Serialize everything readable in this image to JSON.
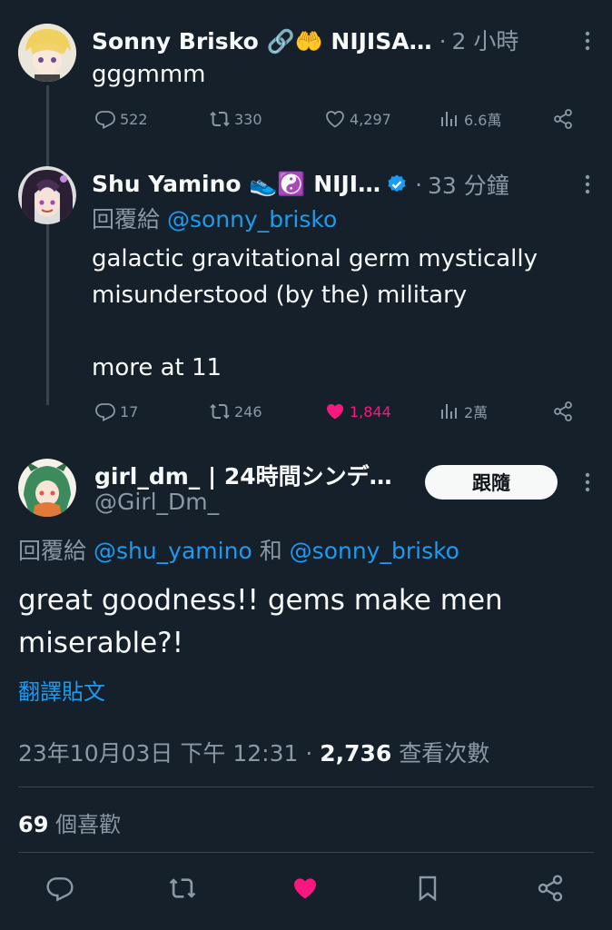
{
  "tweets": [
    {
      "display_name": "Sonny Brisko 🔗🤲 NIJISA…",
      "separator": "·",
      "time": "2 小時",
      "text": "gggmmm",
      "stats": {
        "replies": "522",
        "retweets": "330",
        "likes": "4,297",
        "views": "6.6萬"
      },
      "liked": false
    },
    {
      "display_name": "Shu Yamino 👟☯️ NIJI…",
      "separator": "·",
      "time": "33 分鐘",
      "reply_label": "回覆給",
      "reply_to": "@sonny_brisko",
      "text_line1": "galactic gravitational germ mystically",
      "text_line2": "misunderstood (by the) military",
      "text_line3": "more at 11",
      "stats": {
        "replies": "17",
        "retweets": "246",
        "likes": "1,844",
        "views": "2萬"
      },
      "liked": true
    }
  ],
  "main_tweet": {
    "display_name": "girl_dm_ | 24時間シンデ…",
    "handle": "@Girl_Dm_",
    "follow_label": "跟隨",
    "reply_label": "回覆給",
    "reply_to_1": "@shu_yamino",
    "reply_conj": "和",
    "reply_to_2": "@sonny_brisko",
    "text_line1": "great goodness!! gems make men",
    "text_line2": "miserable?!",
    "translate_label": "翻譯貼文",
    "timestamp": "23年10月03日 下午 12:31",
    "dot": "·",
    "views_count": "2,736",
    "views_label": "查看次數",
    "likes_count": "69",
    "likes_label": "個喜歡"
  },
  "colors": {
    "background": "#15202b",
    "text": "#f7f9f9",
    "muted": "#8b98a5",
    "link": "#1d9bf0",
    "like_pink": "#f91880",
    "divider": "#38444d"
  },
  "icons": [
    "reply-icon",
    "retweet-icon",
    "like-icon",
    "views-icon",
    "share-icon",
    "more-icon",
    "verified-badge-icon",
    "bookmark-icon"
  ]
}
